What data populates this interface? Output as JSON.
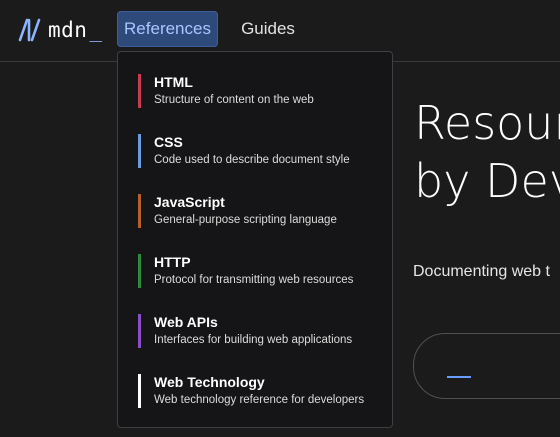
{
  "header": {
    "logo_text": "mdn",
    "logo_underscore": "_",
    "nav": {
      "references": "References",
      "guides": "Guides"
    }
  },
  "hero": {
    "title_line1": "Resour",
    "title_line2": "by Dev",
    "subtitle": "Documenting web t"
  },
  "menu": {
    "items": [
      {
        "title": "HTML",
        "description": "Structure of content on the web",
        "color": "#c73b52"
      },
      {
        "title": "CSS",
        "description": "Code used to describe document style",
        "color": "#6a9cdd"
      },
      {
        "title": "JavaScript",
        "description": "General-purpose scripting language",
        "color": "#b4602c"
      },
      {
        "title": "HTTP",
        "description": "Protocol for transmitting web resources",
        "color": "#2f8a3c"
      },
      {
        "title": "Web APIs",
        "description": "Interfaces for building web applications",
        "color": "#8a4fc6"
      },
      {
        "title": "Web Technology",
        "description": "Web technology reference for developers",
        "color": "#ffffff"
      }
    ]
  },
  "colors": {
    "background": "#1b1b1b",
    "accent": "#8cb4ff",
    "nav_active_bg": "#2e4a7a"
  }
}
